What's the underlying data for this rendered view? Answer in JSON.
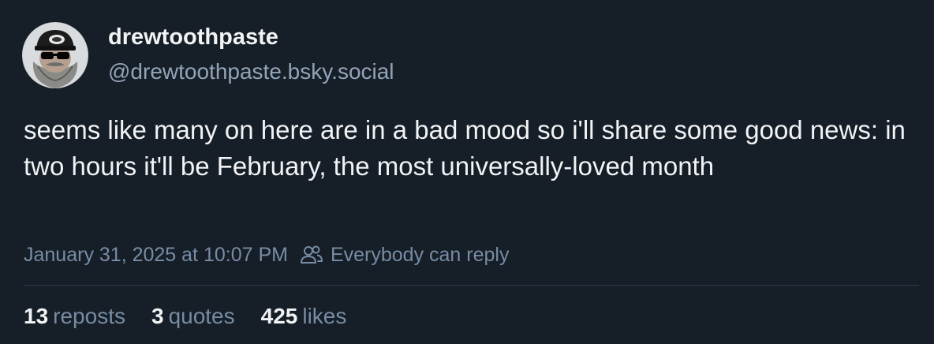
{
  "author": {
    "display_name": "drewtoothpaste",
    "handle": "@drewtoothpaste.bsky.social",
    "avatar_icon": "bearded-man-sunglasses-avatar"
  },
  "post": {
    "text": "seems like many on here are in a bad mood so i'll share some good news: in two hours it'll be February, the most universally-loved month"
  },
  "meta": {
    "timestamp": "January 31, 2025 at 10:07 PM",
    "reply_setting": "Everybody can reply",
    "reply_icon": "people-icon"
  },
  "stats": {
    "reposts_count": "13",
    "reposts_label": "reposts",
    "quotes_count": "3",
    "quotes_label": "quotes",
    "likes_count": "425",
    "likes_label": "likes"
  },
  "colors": {
    "background": "#161e27",
    "primary_text": "#f1f3f5",
    "secondary_text": "#788ca4",
    "handle_text": "#93a4b8",
    "divider": "#2e3b4b"
  }
}
